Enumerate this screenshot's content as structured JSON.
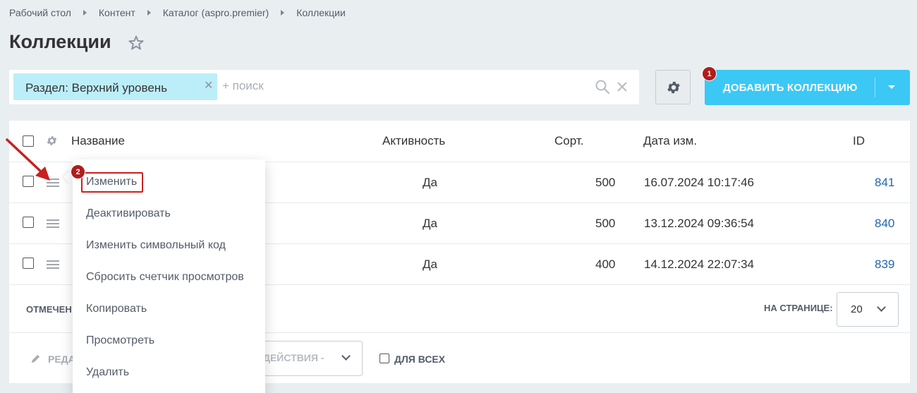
{
  "breadcrumb": [
    "Рабочий стол",
    "Контент",
    "Каталог (aspro.premier)",
    "Коллекции"
  ],
  "page_title": "Коллекции",
  "filter": {
    "tag_label": "Раздел: Верхний уровень",
    "search_placeholder": "+ поиск"
  },
  "add_button": {
    "label": "ДОБАВИТЬ КОЛЛЕКЦИЮ"
  },
  "badges": {
    "one": "1",
    "two": "2"
  },
  "grid": {
    "columns": {
      "name": "Название",
      "active": "Активность",
      "sort": "Сорт.",
      "date": "Дата изм.",
      "id": "ID"
    },
    "rows": [
      {
        "active": "Да",
        "sort": "500",
        "date": "16.07.2024 10:17:46",
        "id": "841"
      },
      {
        "active": "Да",
        "sort": "500",
        "date": "13.12.2024 09:36:54",
        "id": "840"
      },
      {
        "active": "Да",
        "sort": "400",
        "date": "14.12.2024 22:07:34",
        "id": "839"
      }
    ]
  },
  "footer": {
    "marked_label": "ОТМЕЧЕН",
    "per_page_label": "НА СТРАНИЦЕ:",
    "per_page_value": "20",
    "edit_label": "РЕДА",
    "actions_label": "ДЕЙСТВИЯ -",
    "for_all_label": "ДЛЯ ВСЕХ"
  },
  "context_menu": {
    "items": [
      "Изменить",
      "Деактивировать",
      "Изменить символьный код",
      "Сбросить счетчик просмотров",
      "Копировать",
      "Просмотреть",
      "Удалить"
    ]
  },
  "colors": {
    "accent": "#3bc8f5",
    "tag_bg": "#bceef9",
    "annotation_red": "#c8211f",
    "link": "#2067b0"
  },
  "icons": [
    "star-icon",
    "search-icon",
    "clear-icon",
    "gear-icon",
    "chevron-down-icon",
    "burger-icon",
    "pencil-icon",
    "arrow-annotation"
  ]
}
